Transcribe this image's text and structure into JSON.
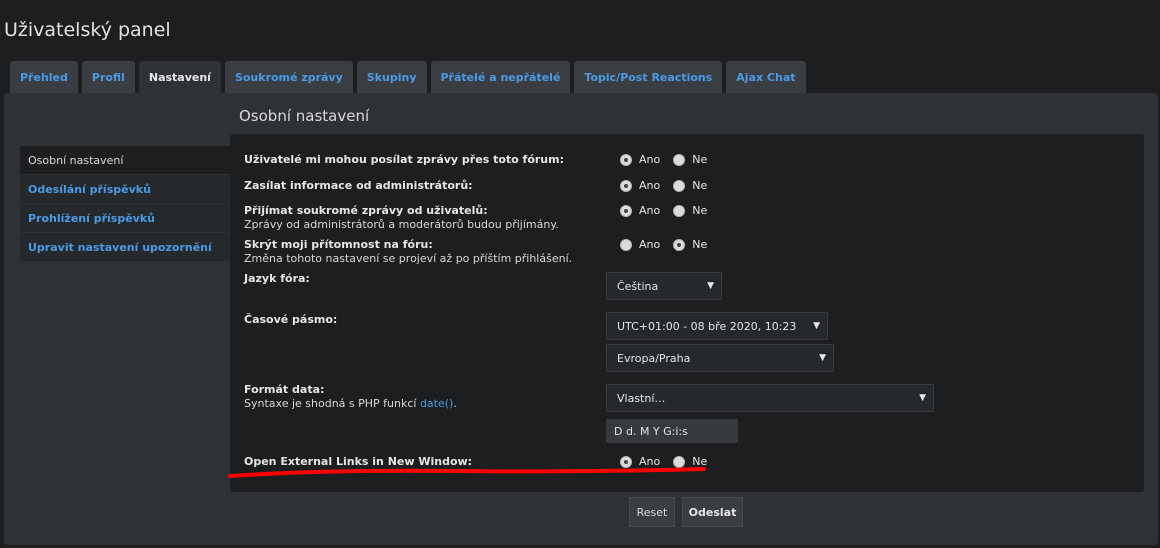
{
  "page": {
    "title": "Uživatelský panel"
  },
  "tabs": [
    {
      "label": "Přehled",
      "active": false
    },
    {
      "label": "Profil",
      "active": false
    },
    {
      "label": "Nastavení",
      "active": true
    },
    {
      "label": "Soukromé zprávy",
      "active": false
    },
    {
      "label": "Skupiny",
      "active": false
    },
    {
      "label": "Přátelé a nepřátelé",
      "active": false
    },
    {
      "label": "Topic/Post Reactions",
      "active": false
    },
    {
      "label": "Ajax Chat",
      "active": false
    }
  ],
  "section": {
    "title": "Osobní nastavení"
  },
  "sidenav": [
    {
      "label": "Osobní nastavení",
      "active": true
    },
    {
      "label": "Odesílání příspěvků",
      "active": false
    },
    {
      "label": "Prohlížení příspěvků",
      "active": false
    },
    {
      "label": "Upravit nastavení upozornění",
      "active": false
    }
  ],
  "form": {
    "yes_label": "Ano",
    "no_label": "Ne",
    "allow_pm": {
      "label": "Uživatelé mi mohou posílat zprávy přes toto fórum:",
      "value": "Ano"
    },
    "admin_email": {
      "label": "Zasílat informace od administrátorů:",
      "value": "Ano"
    },
    "receive_pm": {
      "label": "Přijímat soukromé zprávy od uživatelů:",
      "hint": "Zprávy od administrátorů a moderátorů budou přijímány.",
      "value": "Ano"
    },
    "hide_online": {
      "label": "Skrýt moji přítomnost na fóru:",
      "hint": "Změna tohoto nastavení se projeví až po příštím přihlášení.",
      "value": "Ne"
    },
    "language": {
      "label": "Jazyk fóra:",
      "value": "Čeština"
    },
    "timezone": {
      "label": "Časové pásmo:",
      "date_value": "UTC+01:00 - 08 bře 2020, 10:23",
      "zone_value": "Evropa/Praha"
    },
    "date_format": {
      "label": "Formát data:",
      "hint_prefix": "Syntaxe je shodná s PHP funkcí",
      "hint_link": "date()",
      "hint_suffix": ".",
      "select_value": "Vlastní…",
      "custom_value": "D d. M Y G:i:s"
    },
    "external_links": {
      "label": "Open External Links in New Window:",
      "value": "Ano"
    }
  },
  "buttons": {
    "reset": "Reset",
    "submit": "Odeslat"
  },
  "colors": {
    "accent": "#4a9ae6",
    "background": "#1c1e20",
    "panel": "#2e3236",
    "annotation": "#ff0000"
  }
}
